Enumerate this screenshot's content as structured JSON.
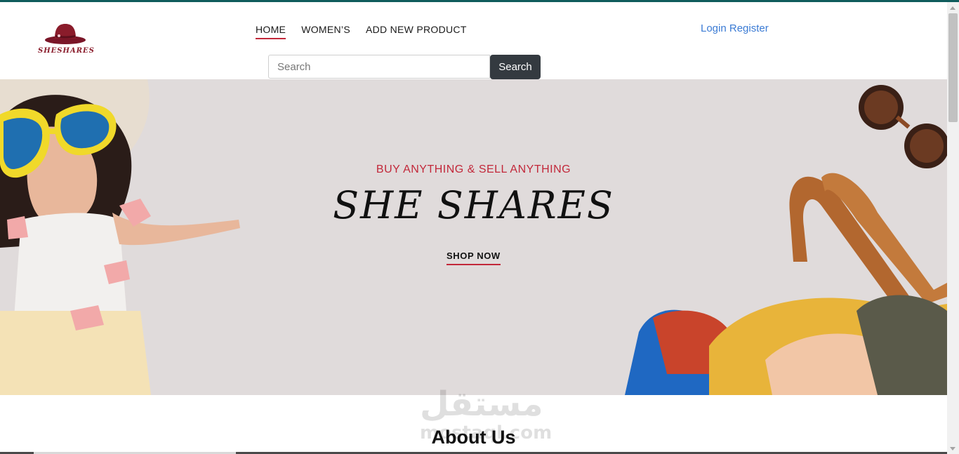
{
  "brand": {
    "name": "SHESHARES",
    "accent_color": "#8a1c2b",
    "icon": "hat-icon"
  },
  "nav": {
    "items": [
      {
        "label": "HOME",
        "active": true
      },
      {
        "label": "WOMEN’S",
        "active": false
      },
      {
        "label": "ADD NEW PRODUCT",
        "active": false
      }
    ]
  },
  "auth": {
    "login_label": "Login",
    "register_label": "Register",
    "color": "#3b7bd4"
  },
  "search": {
    "placeholder": "Search",
    "value": "",
    "button_label": "Search"
  },
  "hero": {
    "tagline": "BUY ANYTHING & SELL ANYTHING",
    "title": "SHE SHARES",
    "cta_label": "SHOP NOW",
    "background": "#e0dbdb",
    "accent": "#c2283a"
  },
  "watermark": {
    "arabic": "مستقل",
    "latin": "mostaql.com"
  },
  "about": {
    "title": "About Us"
  }
}
